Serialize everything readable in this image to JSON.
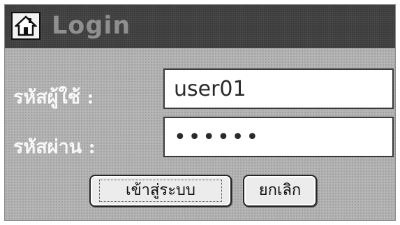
{
  "window": {
    "title": "Login",
    "title_icon": "home-icon"
  },
  "form": {
    "username_label": "รหัสผู้ใช้ :",
    "username_value": "user01",
    "password_label": "รหัสผ่าน :",
    "password_value": "••••••"
  },
  "buttons": {
    "login_label": "เข้าสู่ระบบ",
    "cancel_label": "ยกเลิก"
  },
  "colors": {
    "titlebar": "#383838",
    "dialog_bg": "#b5b5b5",
    "label_text": "#f7f7f7",
    "title_text": "#8f8f8f"
  }
}
